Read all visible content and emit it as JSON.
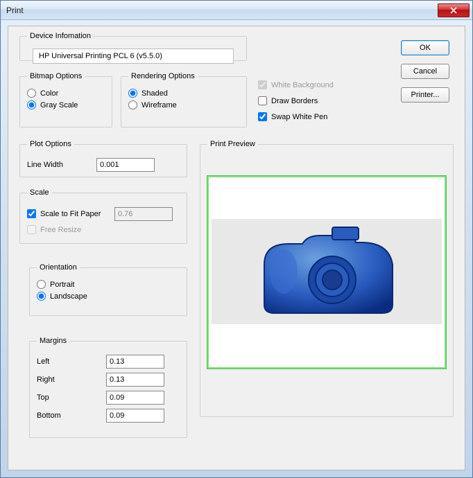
{
  "window": {
    "title": "Print"
  },
  "buttons": {
    "ok": "OK",
    "cancel": "Cancel",
    "printer": "Printer..."
  },
  "device": {
    "legend": "Device Infomation",
    "name": "HP Universal Printing PCL 6 (v5.5.0)"
  },
  "bitmap": {
    "legend": "Bitmap Options",
    "color": "Color",
    "gray": "Gray Scale",
    "selected": "gray"
  },
  "rendering": {
    "legend": "Rendering Options",
    "shaded": "Shaded",
    "wireframe": "Wireframe",
    "selected": "shaded"
  },
  "options": {
    "white_bg": {
      "label": "White Background",
      "checked": true,
      "disabled": true
    },
    "draw_borders": {
      "label": "Draw Borders",
      "checked": false
    },
    "swap_white_pen": {
      "label": "Swap White Pen",
      "checked": true
    }
  },
  "plot": {
    "legend": "Plot Options",
    "line_width_label": "Line Width",
    "line_width": "0.001"
  },
  "scale": {
    "legend": "Scale",
    "fit_label": "Scale to Fit Paper",
    "fit_checked": true,
    "value": "0.76",
    "free_resize": "Free Resize",
    "free_resize_checked": false,
    "free_resize_disabled": true
  },
  "orientation": {
    "legend": "Orientation",
    "portrait": "Portrait",
    "landscape": "Landscape",
    "selected": "landscape"
  },
  "margins": {
    "legend": "Margins",
    "left_label": "Left",
    "left": "0.13",
    "right_label": "Right",
    "right": "0.13",
    "top_label": "Top",
    "top": "0.09",
    "bottom_label": "Bottom",
    "bottom": "0.09"
  },
  "preview": {
    "legend": "Print Preview"
  }
}
